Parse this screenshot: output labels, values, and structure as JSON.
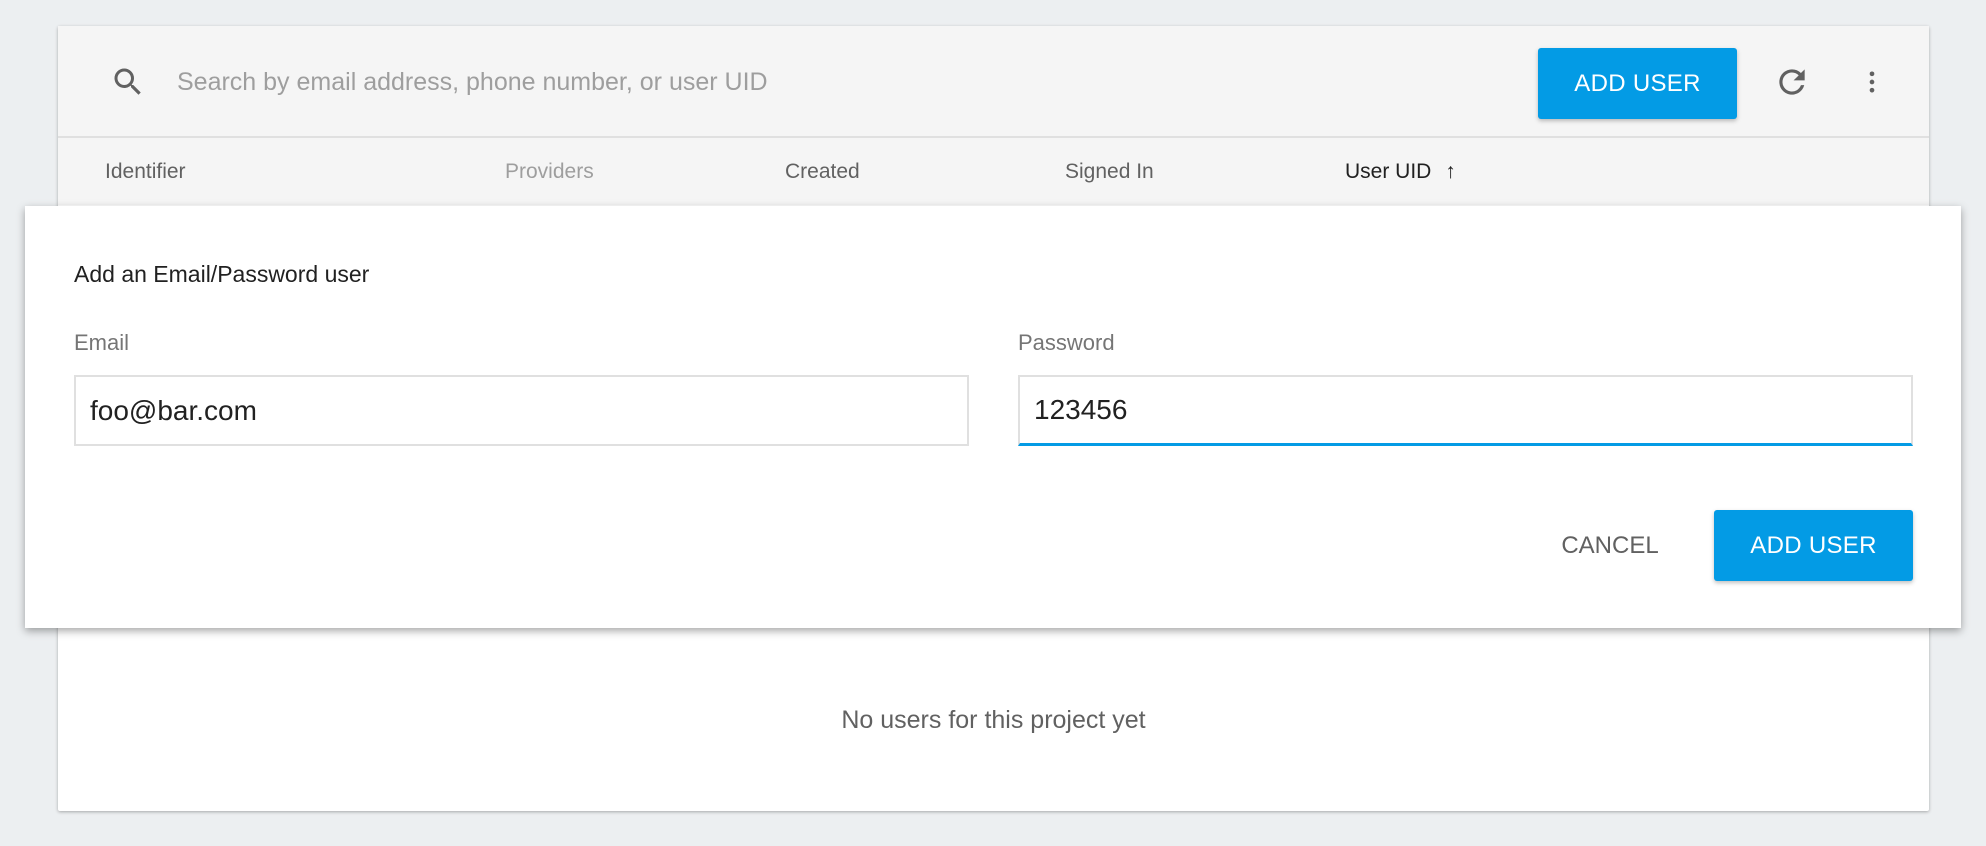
{
  "toolbar": {
    "search_placeholder": "Search by email address, phone number, or user UID",
    "add_user_label": "ADD USER",
    "icons": [
      "search-icon",
      "refresh-icon",
      "more-vert-icon"
    ]
  },
  "table": {
    "columns": [
      "Identifier",
      "Providers",
      "Created",
      "Signed In",
      "User UID"
    ],
    "sort_indicator": "↑",
    "empty_message": "No users for this project yet"
  },
  "dialog": {
    "title": "Add an Email/Password user",
    "email_label": "Email",
    "email_value": "foo@bar.com",
    "password_label": "Password",
    "password_value": "123456",
    "cancel_label": "CANCEL",
    "add_label": "ADD USER"
  },
  "colors": {
    "accent": "#039be5",
    "background": "#eceff1"
  }
}
